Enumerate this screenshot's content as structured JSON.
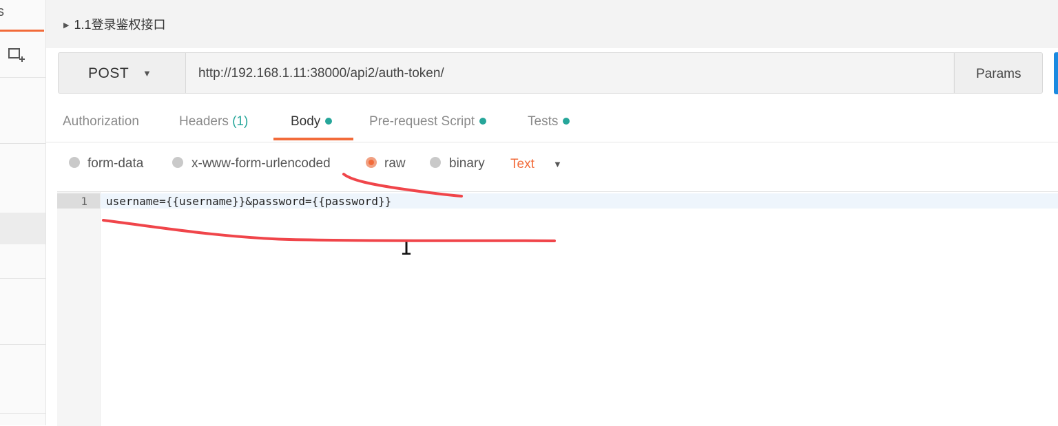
{
  "sidebar": {
    "tab_stub": "s",
    "new_collection_icon": "new-collection-icon"
  },
  "request": {
    "title": "1.1登录鉴权接口",
    "method": "POST",
    "url": "http://192.168.1.11:38000/api2/auth-token/",
    "params_label": "Params"
  },
  "tabs": [
    {
      "label": "Authorization"
    },
    {
      "label": "Headers",
      "count": "(1)"
    },
    {
      "label": "Body",
      "dot": true,
      "active": true
    },
    {
      "label": "Pre-request Script",
      "dot": true
    },
    {
      "label": "Tests",
      "dot": true
    }
  ],
  "body_options": [
    {
      "label": "form-data",
      "selected": false
    },
    {
      "label": "x-www-form-urlencoded",
      "selected": false
    },
    {
      "label": "raw",
      "selected": true
    },
    {
      "label": "binary",
      "selected": false
    }
  ],
  "raw_type": "Text",
  "editor": {
    "line_number": "1",
    "code": "username={{username}}&password={{password}}"
  },
  "colors": {
    "accent": "#f26b3a",
    "dot": "#26a69a",
    "annotation": "#f0454a",
    "send": "#1b8ae0"
  }
}
